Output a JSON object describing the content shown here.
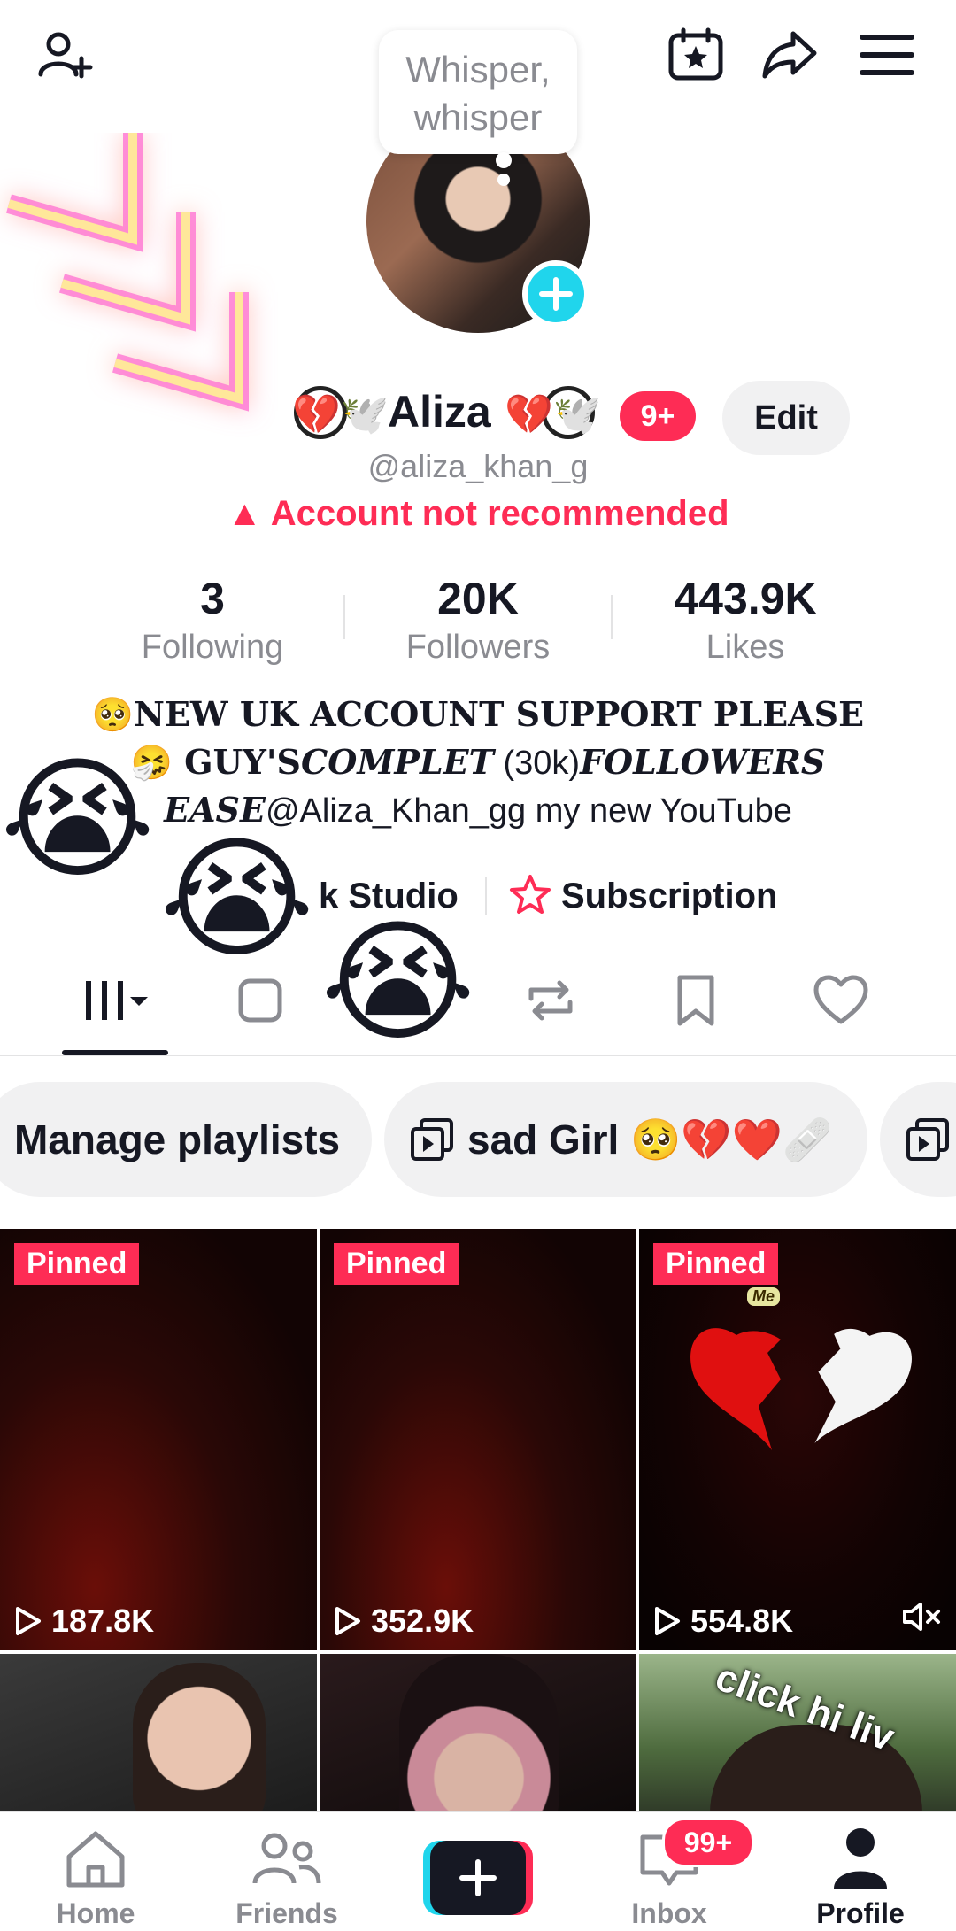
{
  "top": {
    "add_friend_icon": "person-plus-icon",
    "calendar_icon": "calendar-star-icon",
    "share_icon": "share-arrow-icon",
    "menu_icon": "hamburger-menu-icon"
  },
  "bubble": {
    "line1": "Whisper,",
    "line2": "whisper"
  },
  "profile": {
    "name": "Aliza",
    "badge": "9+",
    "edit_label": "Edit",
    "username": "@aliza_khan_g",
    "warning": "Account not recommended"
  },
  "stats": [
    {
      "value": "3",
      "label": "Following"
    },
    {
      "value": "20K",
      "label": "Followers"
    },
    {
      "value": "443.9K",
      "label": "Likes"
    }
  ],
  "bio": {
    "line1": "🥺NEW UK ACCOUNT SUPPORT PLEASE",
    "line2a": "🤧 GUY'S",
    "line2b": "COMPLET",
    "line2c": " (30k)",
    "line2d": "FOLLOWERS",
    "line3a": "EASE",
    "line3b": "@Aliza_Khan_gg my new YouTube"
  },
  "links": {
    "studio": "k Studio",
    "subscription": "Subscription"
  },
  "playlists": [
    {
      "label": "Manage playlists"
    },
    {
      "label": "sad Girl 🥺💔❤️🩹"
    }
  ],
  "videos": [
    {
      "pinned": "Pinned",
      "views": "187.8K"
    },
    {
      "pinned": "Pinned",
      "views": "352.9K"
    },
    {
      "pinned": "Pinned",
      "views": "554.8K",
      "overlay": "Me"
    },
    {
      "caption": ""
    },
    {
      "caption": ""
    },
    {
      "caption": "click hi liv"
    }
  ],
  "nav": {
    "home": "Home",
    "friends": "Friends",
    "inbox": "Inbox",
    "inbox_badge": "99+",
    "profile": "Profile"
  },
  "colors": {
    "accent": "#fe2c55",
    "cyan": "#20d5ec",
    "text": "#161823",
    "muted": "#8a8b91"
  }
}
